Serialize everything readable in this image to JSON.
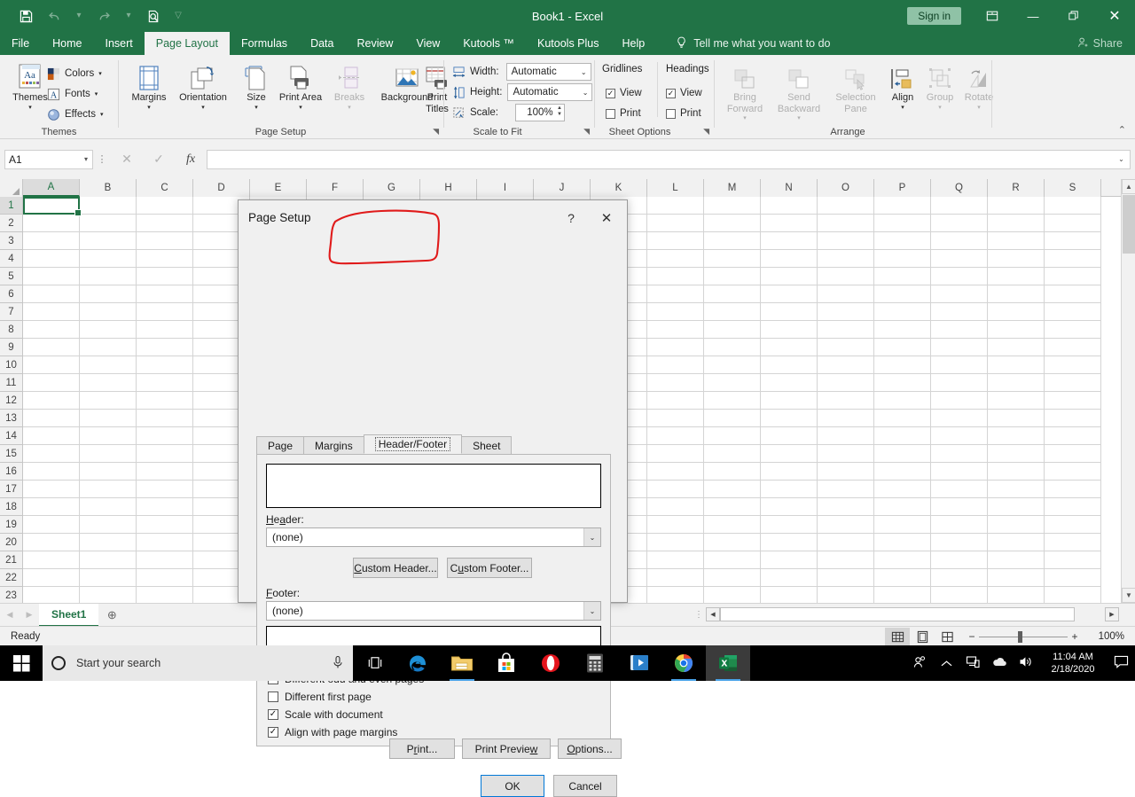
{
  "titlebar": {
    "document_title": "Book1 - Excel",
    "quick_access": [
      {
        "name": "save-icon",
        "glyph": "💾"
      },
      {
        "name": "undo-icon",
        "glyph": "↶"
      },
      {
        "name": "redo-icon",
        "glyph": "↷"
      },
      {
        "name": "print-preview-icon",
        "glyph": "🗎"
      },
      {
        "name": "customize-qat-icon",
        "glyph": "▽"
      }
    ],
    "sign_in_label": "Sign in",
    "ribbon_display_options": "⬜",
    "minimize": "—",
    "restore": "❐",
    "close": "✕"
  },
  "ribbon": {
    "tabs": [
      {
        "label": "File",
        "active": false
      },
      {
        "label": "Home",
        "active": false
      },
      {
        "label": "Insert",
        "active": false
      },
      {
        "label": "Page Layout",
        "active": true
      },
      {
        "label": "Formulas",
        "active": false
      },
      {
        "label": "Data",
        "active": false
      },
      {
        "label": "Review",
        "active": false
      },
      {
        "label": "View",
        "active": false
      },
      {
        "label": "Kutools ™",
        "active": false
      },
      {
        "label": "Kutools Plus",
        "active": false
      },
      {
        "label": "Help",
        "active": false
      }
    ],
    "tell_me": "Tell me what you want to do",
    "share_label": "Share",
    "groups": {
      "themes": {
        "label": "Themes",
        "themes_button": "Themes",
        "colors": "Colors",
        "fonts": "Fonts",
        "effects": "Effects"
      },
      "page_setup": {
        "label": "Page Setup",
        "buttons": [
          {
            "label": "Margins",
            "disabled": false
          },
          {
            "label": "Orientation",
            "disabled": false
          },
          {
            "label": "Size",
            "disabled": false
          },
          {
            "label": "Print Area",
            "disabled": false
          },
          {
            "label": "Breaks",
            "disabled": true
          },
          {
            "label": "Background",
            "disabled": false
          },
          {
            "label": "Print Titles",
            "disabled": false
          }
        ]
      },
      "scale_to_fit": {
        "label": "Scale to Fit",
        "width_label": "Width:",
        "width_value": "Automatic",
        "height_label": "Height:",
        "height_value": "Automatic",
        "scale_label": "Scale:",
        "scale_value": "100%"
      },
      "sheet_options": {
        "label": "Sheet Options",
        "gridlines_label": "Gridlines",
        "headings_label": "Headings",
        "gridlines_view": "View",
        "gridlines_view_checked": true,
        "gridlines_print": "Print",
        "gridlines_print_checked": false,
        "headings_view": "View",
        "headings_view_checked": true,
        "headings_print": "Print",
        "headings_print_checked": false
      },
      "arrange": {
        "label": "Arrange",
        "buttons": [
          {
            "label": "Bring Forward",
            "disabled": true
          },
          {
            "label": "Send Backward",
            "disabled": true
          },
          {
            "label": "Selection Pane",
            "disabled": true
          },
          {
            "label": "Align",
            "disabled": false
          },
          {
            "label": "Group",
            "disabled": true
          },
          {
            "label": "Rotate",
            "disabled": true
          }
        ]
      }
    }
  },
  "formula_bar": {
    "name_box_value": "A1",
    "cancel_icon": "✕",
    "enter_icon": "✓",
    "function_icon": "fx",
    "input_value": "",
    "expand_icon": "⌄"
  },
  "grid": {
    "columns": [
      "A",
      "B",
      "C",
      "D",
      "E",
      "F",
      "G",
      "H",
      "I",
      "J",
      "K",
      "L",
      "M",
      "N",
      "O",
      "P",
      "Q",
      "R",
      "S"
    ],
    "rows": [
      "1",
      "2",
      "3",
      "4",
      "5",
      "6",
      "7",
      "8",
      "9",
      "10",
      "11",
      "12",
      "13",
      "14",
      "15",
      "16",
      "17",
      "18",
      "19",
      "20",
      "21",
      "22",
      "23"
    ],
    "selected_cell": "A1"
  },
  "sheet_bar": {
    "prev_icon": "◀",
    "next_icon": "▶",
    "tabs": [
      {
        "label": "Sheet1",
        "active": true
      }
    ],
    "add_sheet_icon": "⊕"
  },
  "status_bar": {
    "status_text": "Ready",
    "views": [
      {
        "name": "normal-view",
        "glyph": "▦",
        "active": true
      },
      {
        "name": "page-layout-view",
        "glyph": "▤",
        "active": false
      },
      {
        "name": "page-break-preview-view",
        "glyph": "▥",
        "active": false
      }
    ],
    "zoom_out": "−",
    "zoom_in": "+",
    "zoom_level": "100%"
  },
  "dialog": {
    "title": "Page Setup",
    "help_icon": "?",
    "close_icon": "✕",
    "tabs": [
      {
        "label": "Page",
        "active": false
      },
      {
        "label": "Margins",
        "active": false
      },
      {
        "label": "Header/Footer",
        "active": true
      },
      {
        "label": "Sheet",
        "active": false
      }
    ],
    "header_label": "Header:",
    "header_value": "(none)",
    "footer_label": "Footer:",
    "footer_value": "(none)",
    "custom_header_button": "Custom Header...",
    "custom_footer_button": "Custom Footer...",
    "checkboxes": [
      {
        "label": "Different odd and even pages",
        "checked": false
      },
      {
        "label": "Different first page",
        "checked": false
      },
      {
        "label": "Scale with document",
        "checked": true
      },
      {
        "label": "Align with page margins",
        "checked": true
      }
    ],
    "print_button": "Print...",
    "print_preview_button": "Print Preview",
    "options_button": "Options...",
    "ok_button": "OK",
    "cancel_button": "Cancel"
  },
  "annotation": {
    "shape": "hand-drawn-red-rounded-rectangle",
    "target": "Header/Footer",
    "color": "#e01b1b"
  },
  "taskbar": {
    "start_icon": "windows-logo",
    "search_placeholder": "Start your search",
    "mic_icon": "🎙",
    "task_view_icon": "⌸",
    "apps": [
      {
        "name": "edge-icon",
        "label": "e"
      },
      {
        "name": "file-explorer-icon",
        "label": ""
      },
      {
        "name": "microsoft-store-icon",
        "label": ""
      },
      {
        "name": "opera-icon",
        "label": "O"
      },
      {
        "name": "calculator-icon",
        "label": ""
      },
      {
        "name": "movies-tv-icon",
        "label": ""
      },
      {
        "name": "chrome-icon",
        "label": ""
      },
      {
        "name": "excel-icon",
        "label": "X"
      }
    ],
    "tray": [
      {
        "name": "meet-now-icon",
        "glyph": "👤"
      },
      {
        "name": "show-hidden-icons-icon",
        "glyph": "∧"
      },
      {
        "name": "network-icon",
        "glyph": "🖥"
      },
      {
        "name": "onedrive-icon",
        "glyph": "☁"
      },
      {
        "name": "volume-icon",
        "glyph": "🔊"
      }
    ],
    "clock_time": "11:04 AM",
    "clock_date": "2/18/2020",
    "notification_icon": "💬"
  },
  "colors": {
    "excel_green": "#217346",
    "accent_blue": "#0078d7",
    "annotation_red": "#e01b1b"
  }
}
